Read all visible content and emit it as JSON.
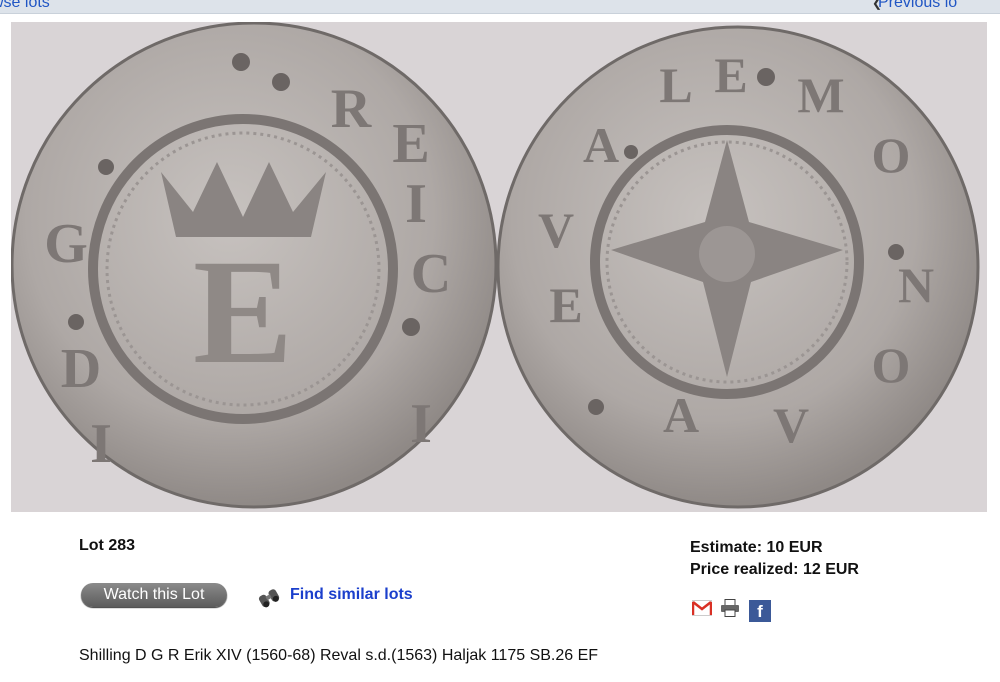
{
  "nav": {
    "browse_label": "wse lots",
    "previous_label": "Previous lo"
  },
  "lot": {
    "title": "Lot 283",
    "estimate": "Estimate: 10 EUR",
    "price_realized": "Price realized: 12 EUR",
    "description": "Shilling D G R Erik XIV (1560-68) Reval s.d.(1563) Haljak 1175 SB.26 EF"
  },
  "actions": {
    "watch_label": "Watch this Lot",
    "find_similar_label": "Find similar lots"
  },
  "share": {
    "icons": [
      "gmail-icon",
      "print-icon",
      "facebook-icon"
    ],
    "facebook_glyph": "f"
  },
  "image": {
    "obverse_legend": [
      "D",
      "G",
      "E",
      "R",
      "I",
      "C",
      "I",
      "I"
    ],
    "obverse_center": "E",
    "reverse_legend": [
      "E",
      "V",
      "A",
      "L",
      "E",
      "M",
      "O",
      "N",
      "O",
      "V",
      "A"
    ],
    "colors": {
      "background": "#d9d4d6",
      "coin": "#b3aeac"
    }
  }
}
